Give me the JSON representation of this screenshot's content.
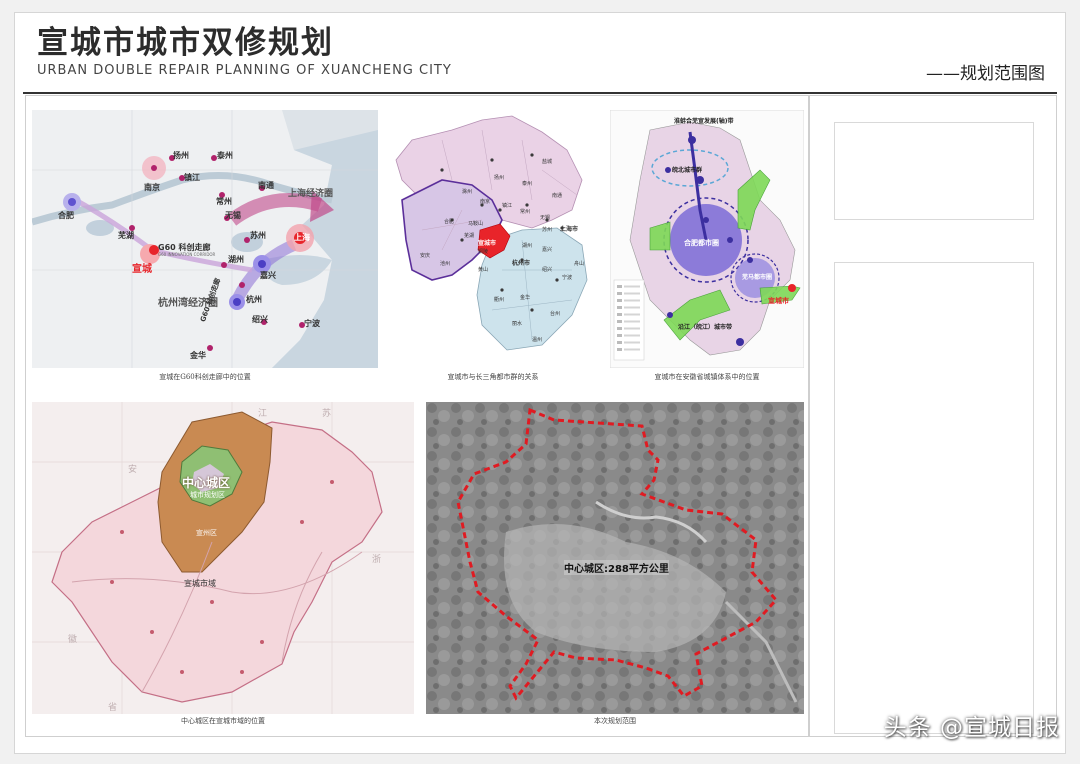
{
  "header": {
    "title_zh": "宣城市城市双修规划",
    "title_en": "URBAN DOUBLE REPAIR PLANNING OF XUANCHENG CITY",
    "subtitle": "——规划范围图"
  },
  "panels": {
    "g60": {
      "caption": "宣城在G60科创走廊中的位置",
      "cities": [
        "扬州",
        "泰州",
        "镇江",
        "南京",
        "常州",
        "南通",
        "无锡",
        "苏州",
        "上海",
        "合肥",
        "芜湖",
        "宣城",
        "湖州",
        "嘉兴",
        "杭州",
        "绍兴",
        "宁波",
        "金华"
      ],
      "labels": {
        "shanghai_circle": "上海经济圈",
        "corridor": "G60 科创走廊",
        "corridor_en": "G60 INNOVATION CORRIDOR",
        "hangzhou_bay": "杭州湾经济圈",
        "corridor_vertical": "G60 科创走廊"
      }
    },
    "yrd": {
      "caption": "宣城市与长三角都市群的关系",
      "highlight": "宣城市",
      "cities": [
        "合肥",
        "南京",
        "镇江",
        "常州",
        "无锡",
        "苏州",
        "上海市",
        "芜湖",
        "马鞍山",
        "湖州",
        "嘉兴",
        "杭州市",
        "绍兴",
        "宁波",
        "金华",
        "衢州",
        "丽水",
        "温州",
        "台州",
        "舟山",
        "黄山",
        "安庆",
        "铜陵",
        "池州",
        "滁州",
        "扬州",
        "泰州",
        "南通",
        "盐城"
      ]
    },
    "anhui": {
      "caption": "宣城市在安徽省城镇体系中的位置",
      "labels": {
        "top_belt": "淮蚌合芜宣发展(轴)带",
        "north_cluster": "皖北城市群",
        "hefei_metro": "合肥都市圈",
        "wuma_metro": "芜马都市圈",
        "xuancheng": "宣城市",
        "river_belt": "沿江（皖江）城市带"
      }
    },
    "county": {
      "caption": "中心城区在宣城市域的位置",
      "labels": {
        "center": "中心城区",
        "planning": "城市规划区",
        "district": "宣州区",
        "city": "宣城市域",
        "prov_jiang": "江",
        "prov_su": "苏",
        "prov_an": "安",
        "prov_hui": "徽",
        "prov_zhe": "浙",
        "prov_sheng": "省"
      }
    },
    "aerial": {
      "caption": "本次规划范围",
      "label": "中心城区:288平方公里"
    }
  },
  "watermark": "头条 @宣城日报",
  "colors": {
    "xuancheng_red": "#e8242a",
    "boundary_red": "#d9141c",
    "county_orange": "#c98a52",
    "hefei_purple": "#7b6bd6",
    "green_arrow": "#7ed957"
  }
}
